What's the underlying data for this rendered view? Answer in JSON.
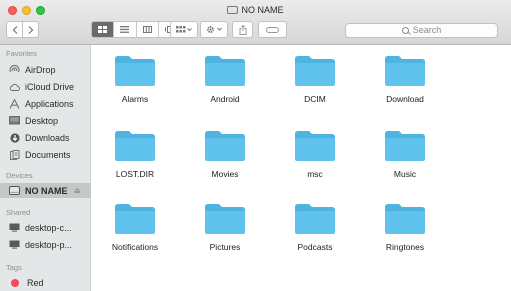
{
  "window": {
    "title": "NO NAME"
  },
  "toolbar": {
    "back_icon": "chevron-left",
    "forward_icon": "chevron-right",
    "view_modes": [
      "icon-view",
      "list-view",
      "column-view",
      "cover-flow-view"
    ],
    "active_view": "icon-view",
    "arrange_icon": "arrange-grid",
    "action_icon": "gear",
    "share_icon": "share",
    "tag_icon": "tag"
  },
  "search": {
    "placeholder": "Search"
  },
  "sidebar": {
    "favorites_heading": "Favorites",
    "favorites": [
      {
        "label": "AirDrop",
        "icon": "airdrop-icon"
      },
      {
        "label": "iCloud Drive",
        "icon": "cloud-icon"
      },
      {
        "label": "Applications",
        "icon": "applications-icon"
      },
      {
        "label": "Desktop",
        "icon": "desktop-icon"
      },
      {
        "label": "Downloads",
        "icon": "downloads-icon"
      },
      {
        "label": "Documents",
        "icon": "documents-icon"
      }
    ],
    "devices_heading": "Devices",
    "devices": [
      {
        "label": "NO NAME",
        "icon": "drive-icon",
        "selected": true,
        "eject": "⏏"
      }
    ],
    "shared_heading": "Shared",
    "shared": [
      {
        "label": "desktop-c...",
        "icon": "computer-icon"
      },
      {
        "label": "desktop-p...",
        "icon": "computer-icon"
      }
    ],
    "tags_heading": "Tags",
    "tags": [
      {
        "label": "Red",
        "color": "#f8485e"
      }
    ]
  },
  "files": [
    "Alarms",
    "Android",
    "DCIM",
    "Download",
    "LOST.DIR",
    "Movies",
    "msc",
    "Music",
    "Notifications",
    "Pictures",
    "Podcasts",
    "Ringtones"
  ],
  "colors": {
    "folder": "#5fc3ee",
    "folder_tab": "#4fb4e2",
    "selected_row": "#c6c7c8",
    "tag_red": "#f8485e"
  }
}
